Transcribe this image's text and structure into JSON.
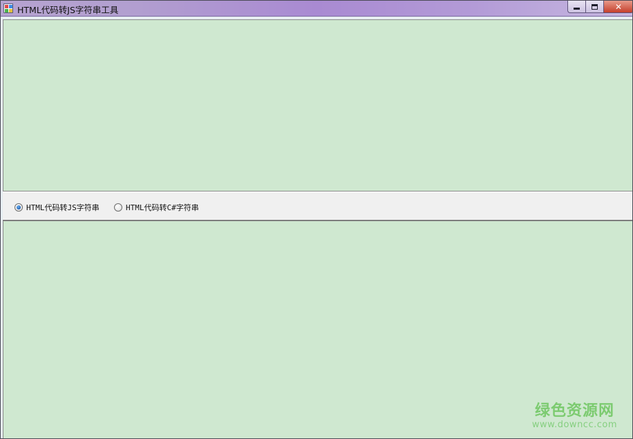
{
  "window": {
    "title": "HTML代码转JS字符串工具",
    "controls": {
      "minimize_icon": "minimize-icon",
      "maximize_icon": "maximize-icon",
      "close_label": "✕"
    }
  },
  "top_textarea": {
    "value": ""
  },
  "options": {
    "radio_js_label": "HTML代码转JS字符串",
    "radio_csharp_label": "HTML代码转C#字符串",
    "selected": "radio_js"
  },
  "bottom_textarea": {
    "value": ""
  },
  "watermark": {
    "cn": "绿色资源网",
    "en": "www.downcc.com"
  },
  "colors": {
    "textarea_bg": "#cfe8d0",
    "strip_bg": "#f0f0f0",
    "radio_dot": "#1e5fb4",
    "watermark": "#7ccb70"
  }
}
